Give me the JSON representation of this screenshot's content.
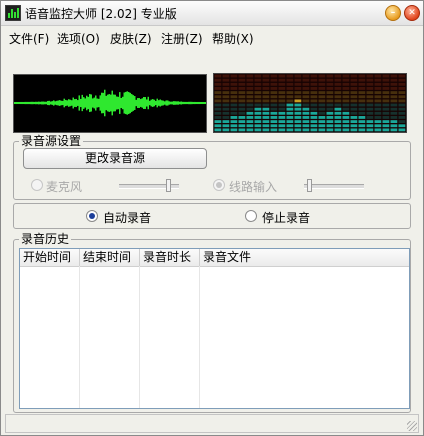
{
  "window": {
    "title": "语音监控大师 [2.02] 专业版",
    "minimize_label": "–",
    "close_label": "✕"
  },
  "menu": [
    {
      "label": "文件(F)"
    },
    {
      "label": "选项(O)"
    },
    {
      "label": "皮肤(Z)"
    },
    {
      "label": "注册(Z)"
    },
    {
      "label": "帮助(X)"
    }
  ],
  "colors": {
    "waveform": "#2fe82f",
    "spectrum_low": "#1aa89a",
    "spectrum_mid": "#c9a026",
    "spectrum_high": "#a83a1a",
    "spectrum_bg": "#160303"
  },
  "source_group": {
    "title": "录音源设置",
    "change_button": "更改录音源",
    "mic": {
      "label": "麦克风",
      "selected": false,
      "enabled": false,
      "level": 0.85
    },
    "line_in": {
      "label": "线路输入",
      "selected": true,
      "enabled": false,
      "level": 0.05
    }
  },
  "mode": {
    "auto_label": "自动录音",
    "auto_selected": true,
    "stop_label": "停止录音",
    "stop_selected": false
  },
  "history": {
    "title": "录音历史",
    "columns": [
      "开始时间",
      "结束时间",
      "录音时长",
      "录音文件"
    ],
    "rows": []
  },
  "status": {
    "text": ""
  }
}
